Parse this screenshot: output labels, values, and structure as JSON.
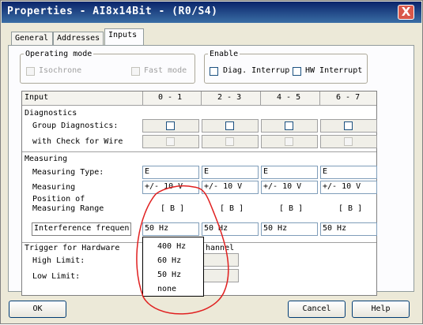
{
  "window": {
    "title": "Properties - AI8x14Bit - (R0/S4)",
    "close_label": "X"
  },
  "tabs": [
    {
      "label": "General"
    },
    {
      "label": "Addresses"
    },
    {
      "label": "Inputs"
    }
  ],
  "operating_mode": {
    "legend": "Operating mode",
    "isochrone": "Isochrone",
    "fast_mode": "Fast mode"
  },
  "enable": {
    "legend": "Enable",
    "diag_interrupt": "Diag. Interrup",
    "hw_interrupt": "HW Interrupt"
  },
  "grid": {
    "header": {
      "input": "Input",
      "cols": [
        "0 - 1",
        "2 - 3",
        "4 - 5",
        "6 - 7"
      ]
    },
    "diagnostics": {
      "title": "Diagnostics",
      "group": "Group Diagnostics:",
      "wire": "with Check for Wire"
    },
    "measuring": {
      "title": "Measuring",
      "type_label": "Measuring Type:",
      "types": [
        "E",
        "E",
        "E",
        "E"
      ],
      "range_label": "Measuring",
      "ranges": [
        "+/- 10 V",
        "+/- 10 V",
        "+/- 10 V",
        "+/- 10 V"
      ],
      "position_label_1": "Position of",
      "position_label_2": "Measuring Range",
      "positions": [
        "[ B ]",
        "[ B ]",
        "[ B ]",
        "[ B ]"
      ],
      "interference_label": "Interference frequen",
      "interference": [
        "50 Hz",
        "50 Hz",
        "50 Hz",
        "50 Hz"
      ]
    },
    "trigger": {
      "title": "Trigger for Hardware",
      "channel": "hannel",
      "high": "High Limit:",
      "low": "Low Limit:"
    }
  },
  "dropdown": {
    "options": [
      "400 Hz",
      "60 Hz",
      "50 Hz",
      "none"
    ]
  },
  "buttons": {
    "ok": "OK",
    "cancel": "Cancel",
    "help": "Help"
  }
}
